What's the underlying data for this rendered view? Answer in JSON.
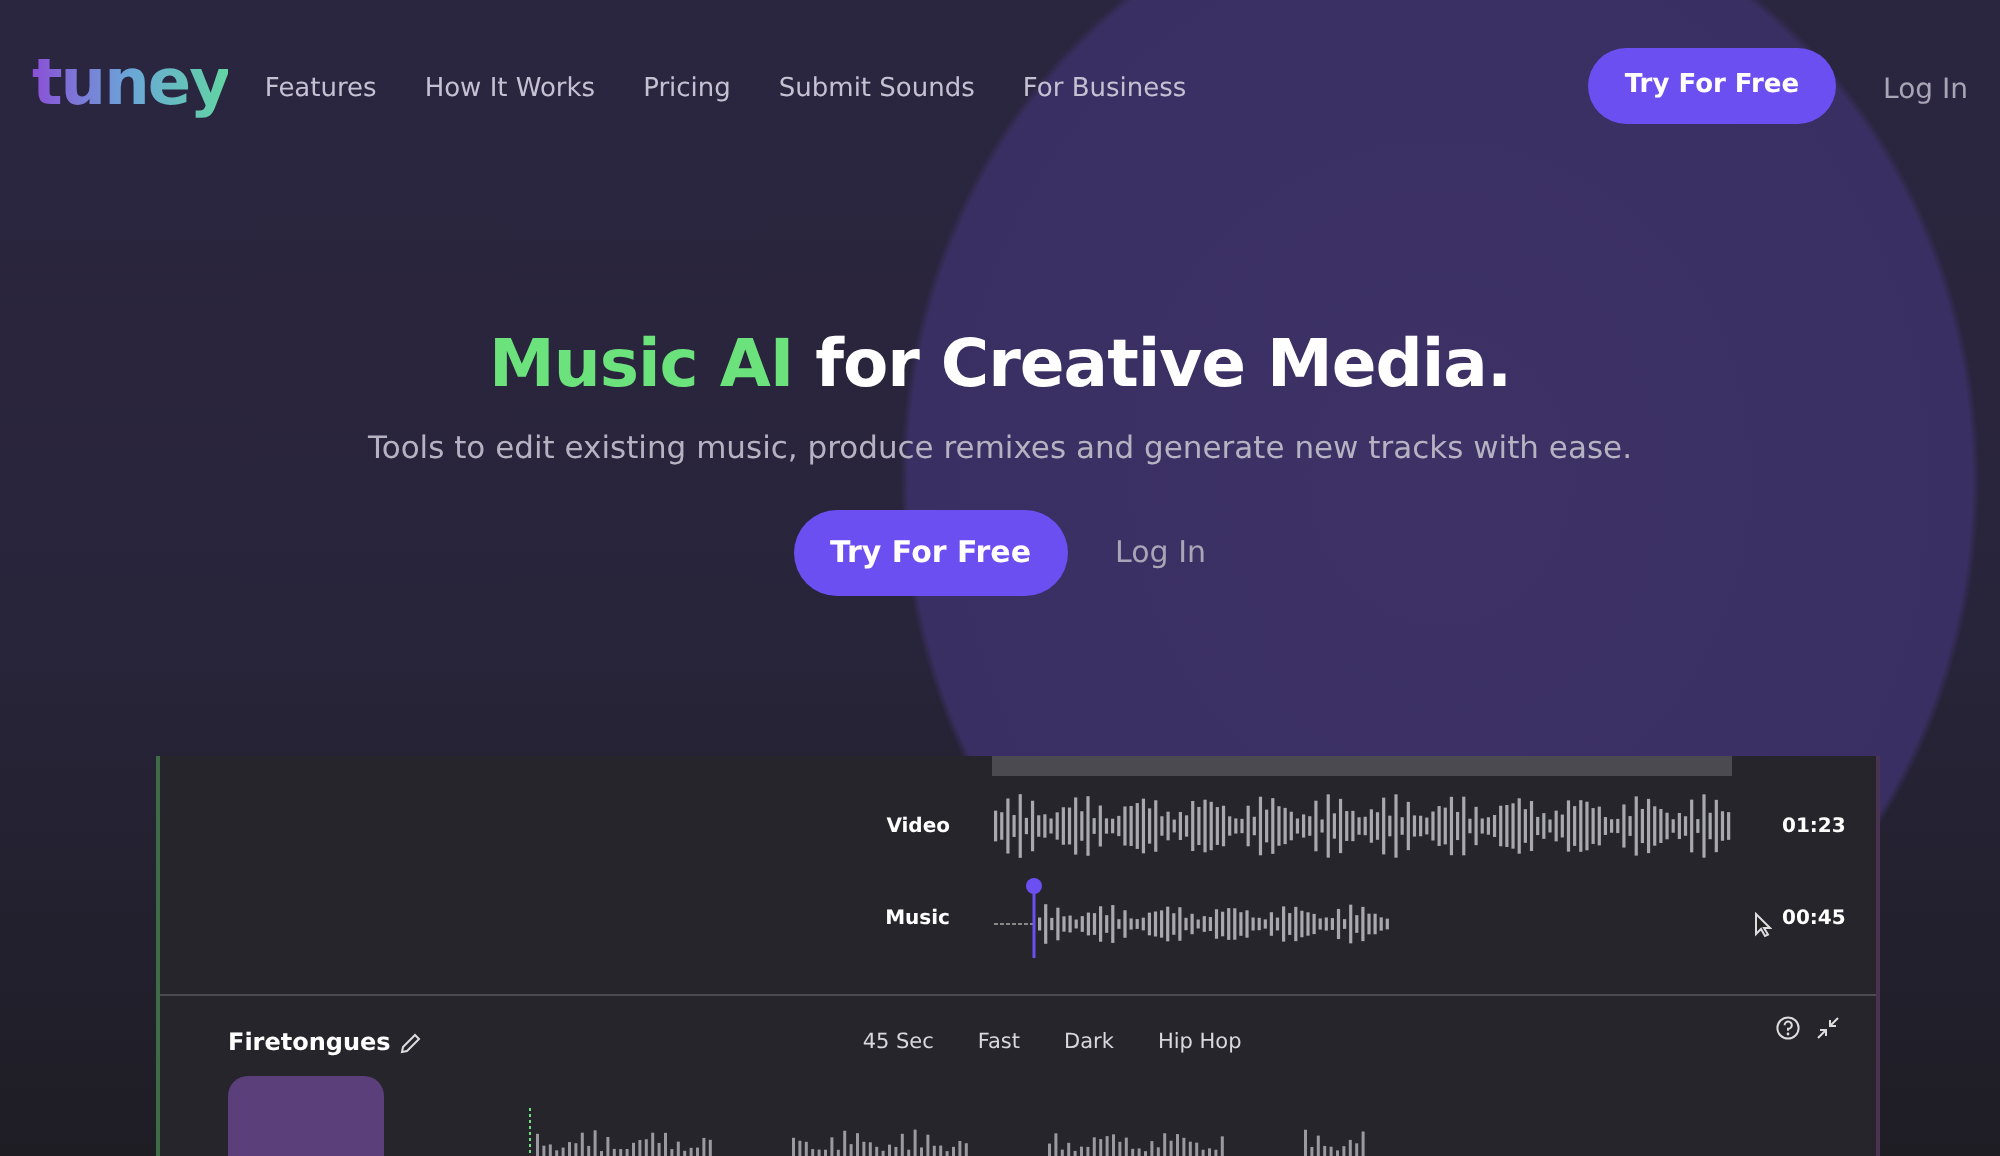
{
  "header": {
    "logo": "tuney",
    "nav": [
      "Features",
      "How It Works",
      "Pricing",
      "Submit Sounds",
      "For Business"
    ],
    "cta": "Try For Free",
    "login": "Log In"
  },
  "hero": {
    "highlight": "Music AI",
    "title_rest": " for Creative Media.",
    "subtitle": "Tools to edit existing music, produce remixes and generate new tracks with ease.",
    "cta": "Try For Free",
    "login": "Log In"
  },
  "editor": {
    "tracks": [
      {
        "label": "Video",
        "time": "01:23",
        "kind": "full"
      },
      {
        "label": "Music",
        "time": "00:45",
        "kind": "playhead"
      }
    ],
    "song": {
      "title": "Firetongues",
      "tags": [
        "45 Sec",
        "Fast",
        "Dark",
        "Hip Hop"
      ]
    }
  }
}
